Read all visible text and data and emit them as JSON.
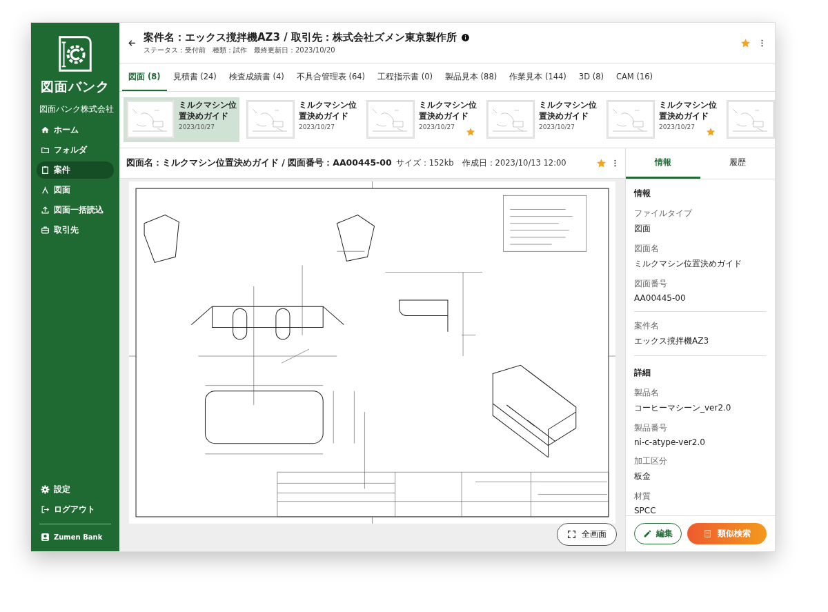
{
  "sidebar": {
    "brand": "図面バンク",
    "company": "図面バンク株式会社",
    "nav": [
      {
        "kind": "home",
        "label": "ホーム",
        "selected": false
      },
      {
        "kind": "folder",
        "label": "フォルダ",
        "selected": false
      },
      {
        "kind": "clipboard",
        "label": "案件",
        "selected": true
      },
      {
        "kind": "compass",
        "label": "図面",
        "selected": false
      },
      {
        "kind": "upload",
        "label": "図面一括読込",
        "selected": false
      },
      {
        "kind": "briefcase",
        "label": "取引先",
        "selected": false
      }
    ],
    "bottom": [
      {
        "kind": "gear",
        "label": "設定"
      },
      {
        "kind": "logout",
        "label": "ログアウト"
      }
    ],
    "user": "Zumen Bank"
  },
  "header": {
    "title": "案件名：エックス撹拌機AZ3 / 取引先：株式会社ズメン東京製作所",
    "meta": "ステータス：受付前　種類：試作　最終更新日：2023/10/20",
    "starred": true
  },
  "tabs": [
    {
      "label": "図面 (8)",
      "selected": true
    },
    {
      "label": "見積書 (24)",
      "selected": false
    },
    {
      "label": "検査成績書 (4)",
      "selected": false
    },
    {
      "label": "不具合管理表 (64)",
      "selected": false
    },
    {
      "label": "工程指示書 (0)",
      "selected": false
    },
    {
      "label": "製品見本 (88)",
      "selected": false
    },
    {
      "label": "作業見本 (144)",
      "selected": false
    },
    {
      "label": "3D (8)",
      "selected": false
    },
    {
      "label": "CAM (16)",
      "selected": false
    }
  ],
  "thumbnails": [
    {
      "title": "ミルクマシン位置決めガイド",
      "date": "2023/10/27",
      "selected": true,
      "starred": false
    },
    {
      "title": "ミルクマシン位置決めガイド",
      "date": "2023/10/27",
      "selected": false,
      "starred": false
    },
    {
      "title": "ミルクマシン位置決めガイド",
      "date": "2023/10/27",
      "selected": false,
      "starred": true
    },
    {
      "title": "ミルクマシン位置決めガイド",
      "date": "2023/10/27",
      "selected": false,
      "starred": false
    },
    {
      "title": "ミルクマシン位置決めガイド",
      "date": "2023/10/27",
      "selected": false,
      "starred": true
    },
    {
      "selected": false,
      "starred": false
    }
  ],
  "viewer": {
    "title": "図面名：ミルクマシン位置決めガイド / 図面番号：AA00445-00",
    "meta": "サイズ：152kb　作成日：2023/10/13 12:00",
    "starred": true,
    "fullscreen": "全画面"
  },
  "panel": {
    "tabs": [
      {
        "label": "情報",
        "selected": true
      },
      {
        "label": "履歴",
        "selected": false
      }
    ],
    "blocks": [
      {
        "kind": "heading",
        "text": "情報"
      },
      {
        "kind": "field",
        "label": "ファイルタイプ",
        "value": "図面"
      },
      {
        "kind": "field",
        "label": "図面名",
        "value": "ミルクマシン位置決めガイド"
      },
      {
        "kind": "field",
        "label": "図面番号",
        "value": "AA00445-00"
      },
      {
        "kind": "divider"
      },
      {
        "kind": "field",
        "label": "案件名",
        "value": "エックス撹拌機AZ3"
      },
      {
        "kind": "divider"
      },
      {
        "kind": "heading",
        "text": "詳細"
      },
      {
        "kind": "field",
        "label": "製品名",
        "value": "コーヒーマシーン_ver2.0"
      },
      {
        "kind": "field",
        "label": "製品番号",
        "value": "ni-c-atype-ver2.0"
      },
      {
        "kind": "field",
        "label": "加工区分",
        "value": "板金"
      },
      {
        "kind": "field",
        "label": "材質",
        "value": "SPCC"
      }
    ],
    "edit": "編集",
    "search": "類似検索"
  }
}
